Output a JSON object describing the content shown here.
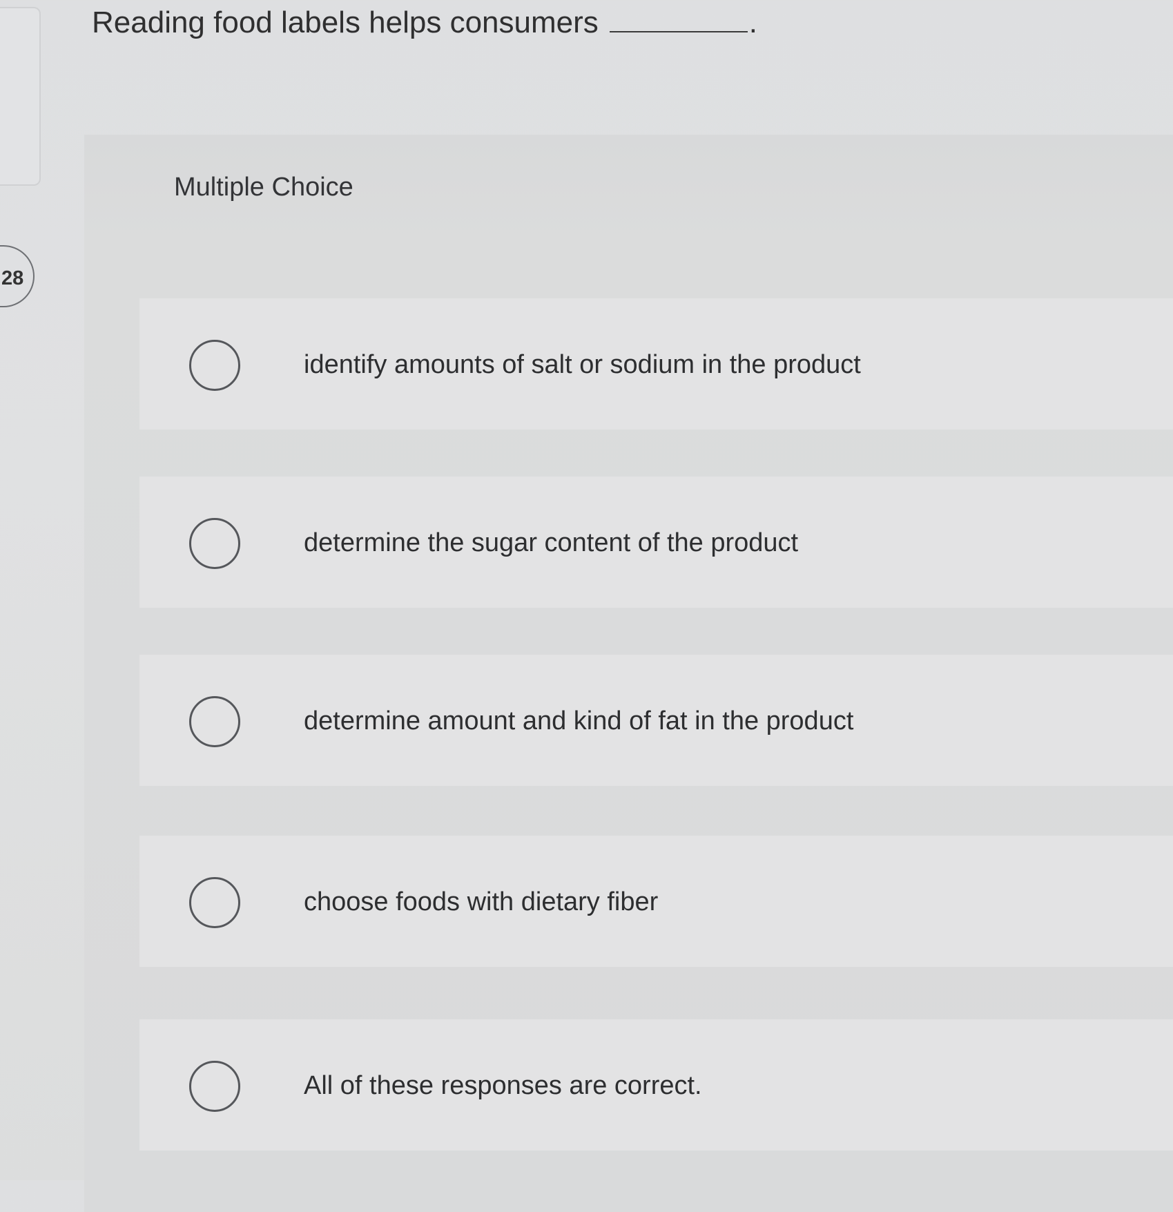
{
  "question": {
    "number": "28",
    "prompt": "Reading food labels helps consumers",
    "prompt_end": "."
  },
  "panel": {
    "type_label": "Multiple Choice"
  },
  "options": [
    {
      "label": "identify amounts of salt or sodium in the product",
      "selected": false
    },
    {
      "label": "determine the sugar content of the product",
      "selected": false
    },
    {
      "label": "determine amount and kind of fat in the product",
      "selected": false
    },
    {
      "label": "choose foods with dietary fiber",
      "selected": false
    },
    {
      "label": "All of these responses are correct.",
      "selected": false
    }
  ]
}
